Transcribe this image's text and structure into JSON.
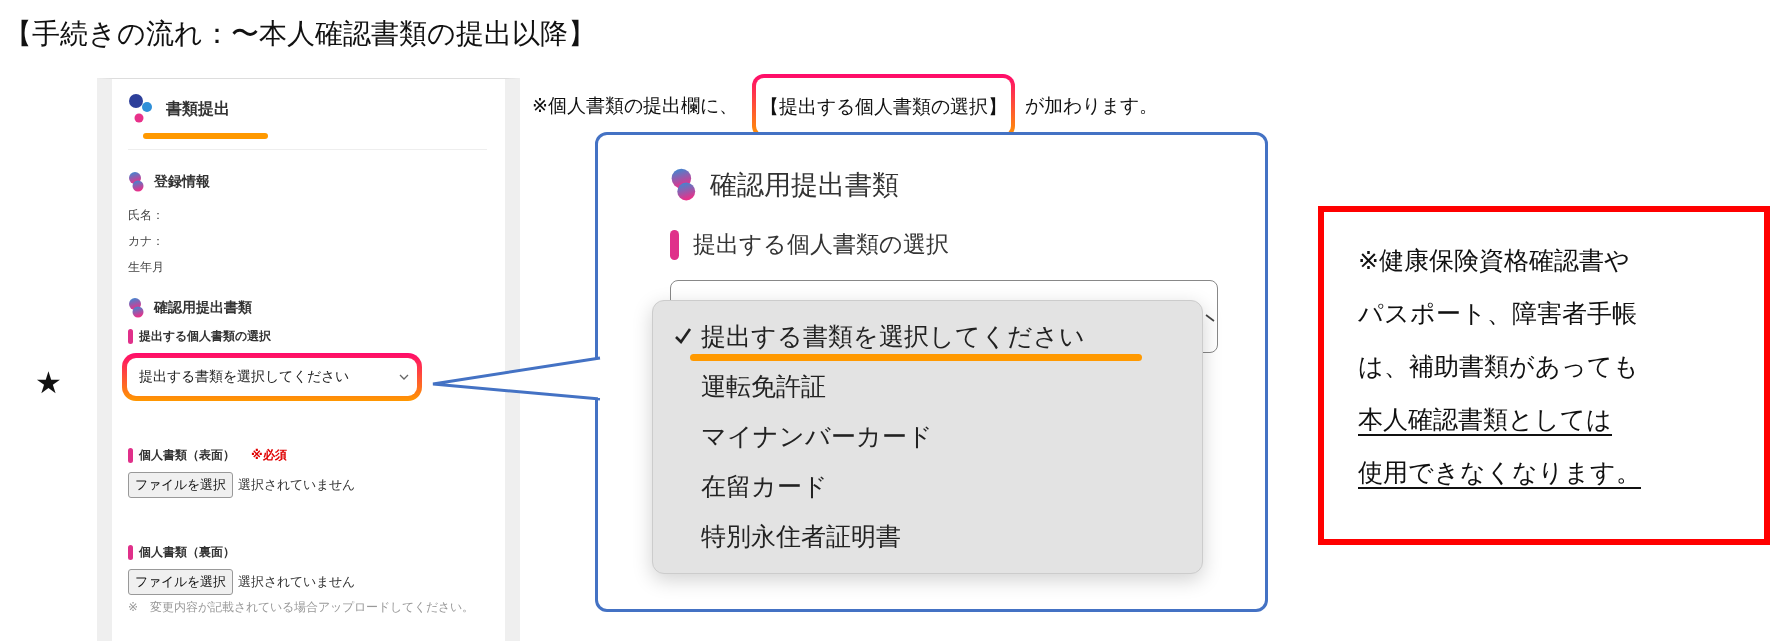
{
  "title": "【手続きの流れ：〜本人確認書類の提出以降】",
  "marker": "★",
  "form": {
    "title": "書類提出",
    "registration": {
      "heading": "登録情報",
      "fields": [
        "氏名：",
        "カナ：",
        "生年月"
      ]
    },
    "documents": {
      "heading": "確認用提出書類",
      "select_label": "提出する個人書類の選択",
      "select_value": "提出する書類を選択してください",
      "uploads": [
        {
          "label": "個人書類（表面）",
          "required": "※必須",
          "button": "ファイルを選択",
          "status": "選択されていません"
        },
        {
          "label": "個人書類（裏面）",
          "button": "ファイルを選択",
          "status": "選択されていません",
          "hint": "※　変更内容が記載されている場合アップロードしてください。"
        }
      ]
    }
  },
  "note": {
    "before": "※個人書類の提出欄に、",
    "highlight": "【提出する個人書類の選択】",
    "after": "が加わります。"
  },
  "callout": {
    "heading": "確認用提出書類",
    "select_label": "提出する個人書類の選択",
    "options": [
      {
        "label": "提出する書類を選択してください",
        "selected": true
      },
      {
        "label": "運転免許証",
        "selected": false
      },
      {
        "label": "マイナンバーカード",
        "selected": false
      },
      {
        "label": "在留カード",
        "selected": false
      },
      {
        "label": "特別永住者証明書",
        "selected": false
      }
    ]
  },
  "warning": {
    "lines": [
      {
        "text": "※健康保険資格確認書や",
        "underlined": false
      },
      {
        "text": "パスポート、障害者手帳",
        "underlined": false
      },
      {
        "text": "は、補助書類があっても",
        "underlined": false
      },
      {
        "text": "本人確認書類としては",
        "underlined": true
      },
      {
        "text": "使用できなくなります。",
        "underlined": true
      }
    ]
  }
}
